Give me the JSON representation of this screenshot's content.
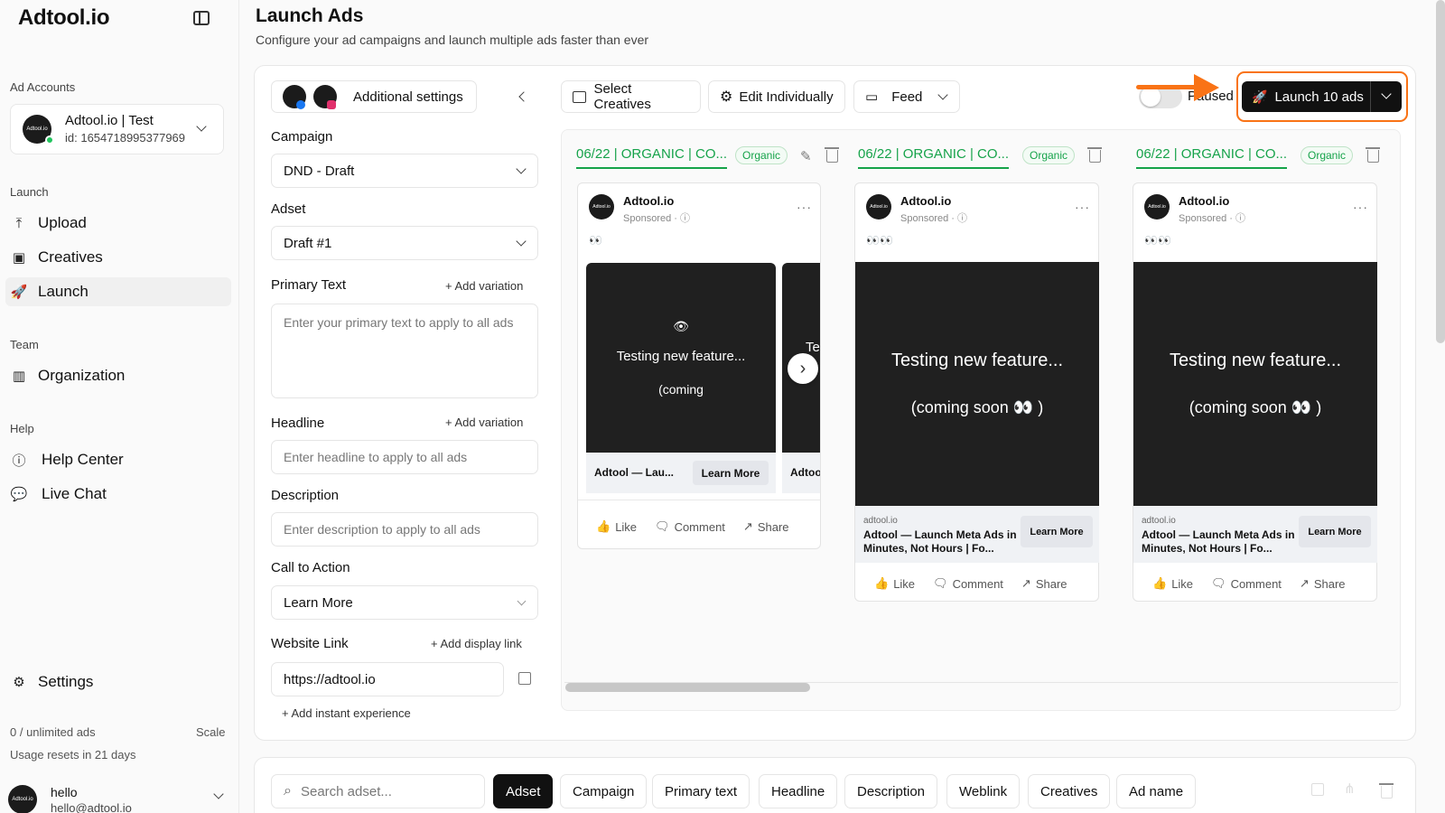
{
  "sidebar": {
    "brand": "Adtool.io",
    "ad_accounts_label": "Ad Accounts",
    "account": {
      "avatar_text": "Adtool.io",
      "name": "Adtool.io | Test",
      "id": "id: 1654718995377969"
    },
    "launch_label": "Launch",
    "launch_items": [
      {
        "label": "Upload",
        "icon": "upload-icon"
      },
      {
        "label": "Creatives",
        "icon": "image-icon"
      },
      {
        "label": "Launch",
        "icon": "rocket-icon"
      }
    ],
    "team_label": "Team",
    "team_items": [
      {
        "label": "Organization",
        "icon": "building-icon"
      }
    ],
    "help_label": "Help",
    "help_items": [
      {
        "label": "Help Center",
        "icon": "question-icon"
      },
      {
        "label": "Live Chat",
        "icon": "chat-icon"
      }
    ],
    "settings_label": "Settings",
    "usage": "0 / unlimited ads",
    "scale": "Scale",
    "reset": "Usage resets in 21 days",
    "user": {
      "name": "hello",
      "email": "hello@adtool.io",
      "avatar_text": "Adtool.io"
    }
  },
  "header": {
    "title": "Launch Ads",
    "subtitle": "Configure your ad campaigns and launch multiple ads faster than ever"
  },
  "settings": {
    "additional_settings": "Additional settings",
    "campaign_label": "Campaign",
    "campaign_value": "DND - Draft",
    "adset_label": "Adset",
    "adset_value": "Draft #1",
    "primary_text_label": "Primary Text",
    "add_variation": "+ Add variation",
    "primary_text_placeholder": "Enter your primary text to apply to all ads",
    "headline_label": "Headline",
    "headline_placeholder": "Enter headline to apply to all ads",
    "description_label": "Description",
    "description_placeholder": "Enter description to apply to all ads",
    "cta_label": "Call to Action",
    "cta_value": "Learn More",
    "website_label": "Website Link",
    "add_display_link": "+ Add display link",
    "website_value": "https://adtool.io",
    "add_instant": "+ Add instant experience"
  },
  "toolbar": {
    "select_creatives": "Select Creatives",
    "edit_individually": "Edit Individually",
    "feed": "Feed",
    "paused": "Paused",
    "launch": "Launch 10 ads"
  },
  "ads": [
    {
      "tab": "06/22 | ORGANIC | CO...",
      "badge": "Organic",
      "brand": "Adtool.io",
      "sponsored": "Sponsored · ⓘ",
      "emoji": "👀",
      "media_text": "Testing new feature...",
      "media_sub": "(coming",
      "footer_title": "Adtool — Lau...",
      "footer_title_next": "Adtoo",
      "media_next": "Te",
      "cta": "Learn More"
    },
    {
      "tab": "06/22 | ORGANIC | CO...",
      "badge": "Organic",
      "brand": "Adtool.io",
      "sponsored": "Sponsored · ⓘ",
      "emoji": "👀👀",
      "media_text": "Testing new feature...",
      "media_sub": "(coming soon 👀 )",
      "domain": "adtool.io",
      "footer_title": "Adtool — Launch Meta Ads in Minutes, Not Hours | Fo...",
      "cta": "Learn More"
    },
    {
      "tab": "06/22 | ORGANIC | CO...",
      "badge": "Organic",
      "brand": "Adtool.io",
      "sponsored": "Sponsored · ⓘ",
      "emoji": "👀👀",
      "media_text": "Testing new feature...",
      "media_sub": "(coming soon 👀 )",
      "domain": "adtool.io",
      "footer_title": "Adtool — Launch Meta Ads in Minutes, Not Hours | Fo...",
      "cta": "Learn More"
    }
  ],
  "reactions": {
    "like": "Like",
    "comment": "Comment",
    "share": "Share"
  },
  "filters": {
    "search_placeholder": "Search adset...",
    "chips": [
      "Adset",
      "Campaign",
      "Primary text",
      "Headline",
      "Description",
      "Weblink",
      "Creatives",
      "Ad name"
    ]
  },
  "colors": {
    "accent_green": "#16a34a",
    "highlight_orange": "#f97316",
    "dark": "#111111"
  }
}
